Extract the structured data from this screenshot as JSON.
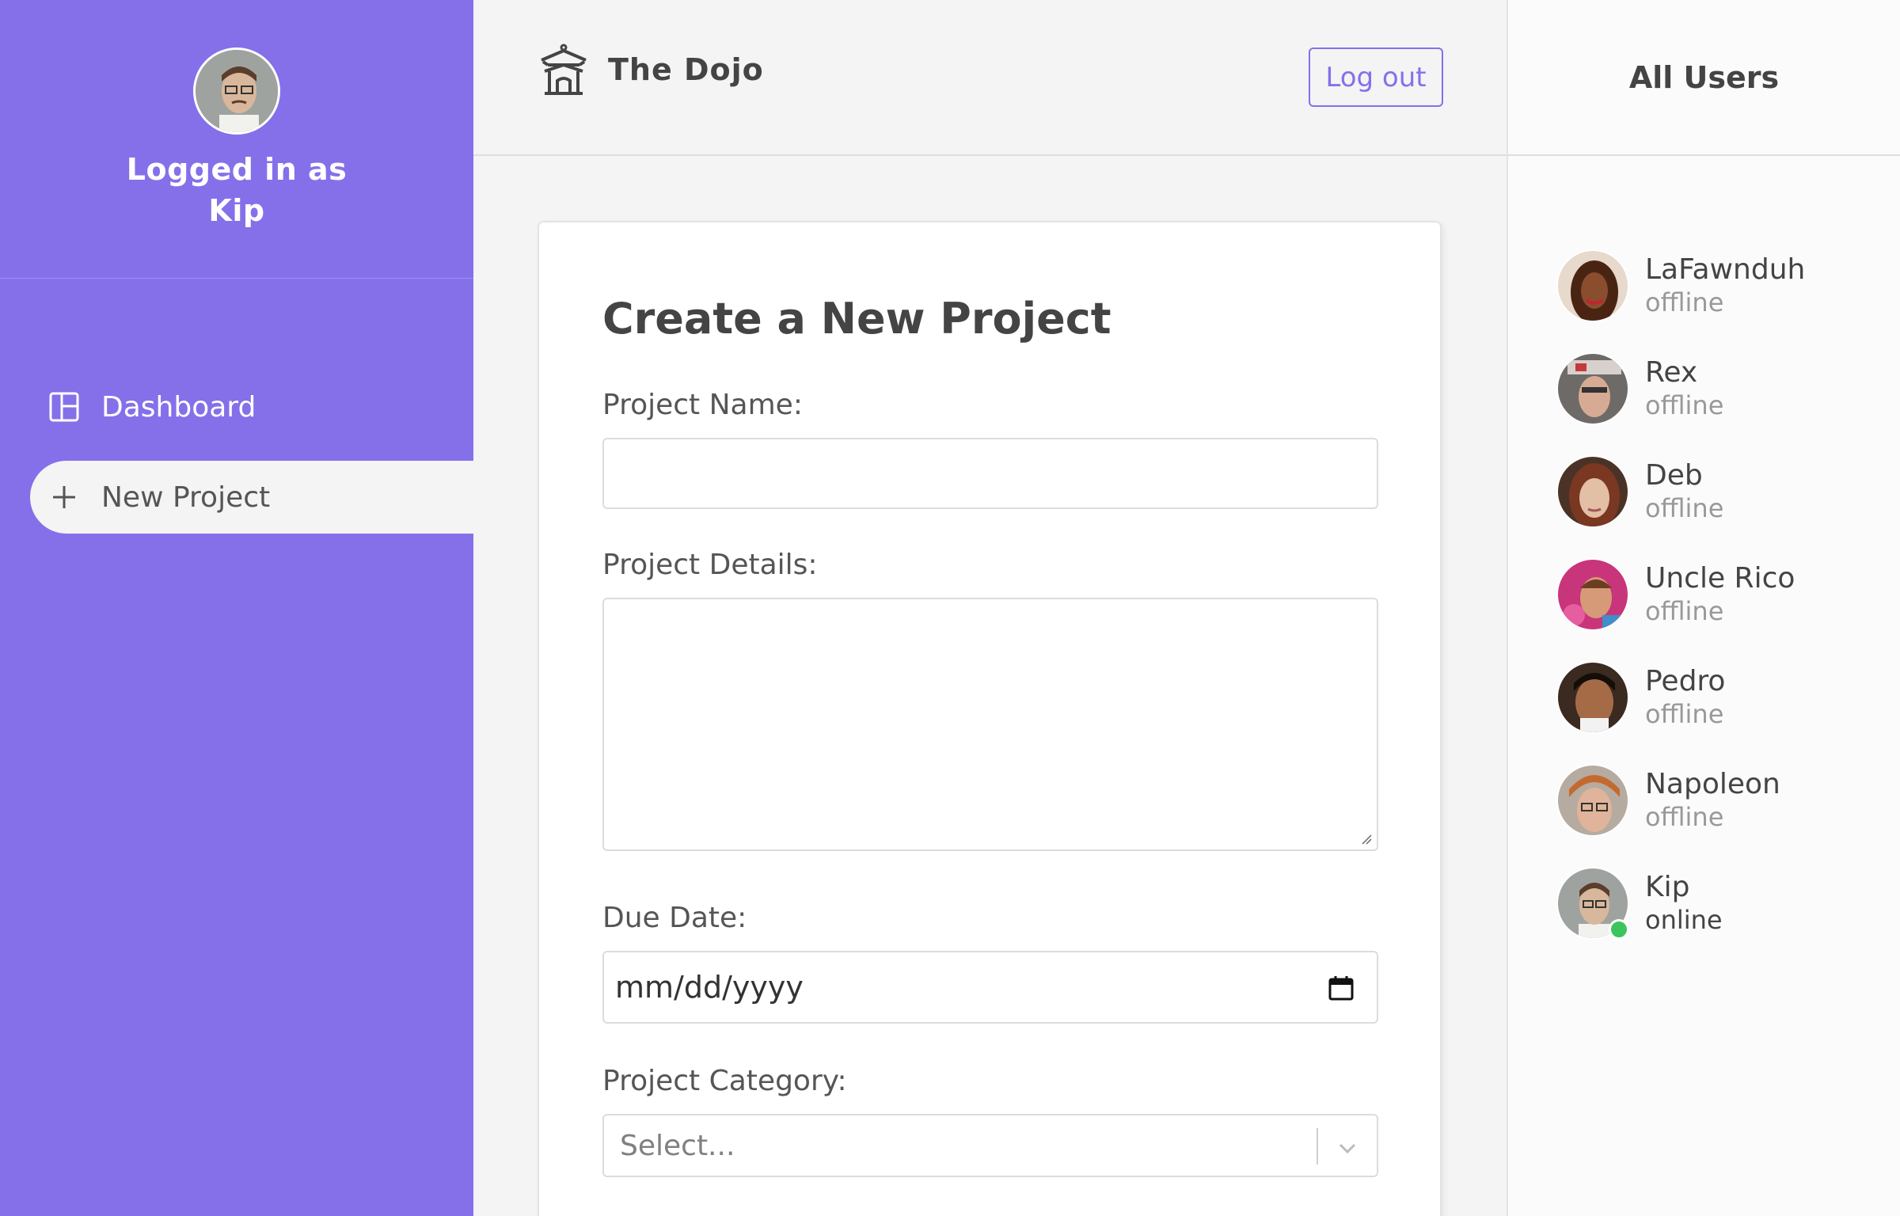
{
  "sidebar": {
    "login_text": "Logged in as Kip",
    "nav": [
      {
        "label": "Dashboard",
        "icon": "dashboard-icon"
      },
      {
        "label": "New Project",
        "icon": "plus-icon"
      }
    ]
  },
  "header": {
    "brand": "The Dojo",
    "logout_label": "Log out"
  },
  "form": {
    "title": "Create a New Project",
    "name_label": "Project Name:",
    "details_label": "Project Details:",
    "due_label": "Due Date:",
    "due_placeholder": "mm/dd/yyyy",
    "category_label": "Project Category:",
    "category_placeholder": "Select..."
  },
  "users": {
    "heading": "All Users",
    "list": [
      {
        "name": "LaFawnduh",
        "status": "offline"
      },
      {
        "name": "Rex",
        "status": "offline"
      },
      {
        "name": "Deb",
        "status": "offline"
      },
      {
        "name": "Uncle Rico",
        "status": "offline"
      },
      {
        "name": "Pedro",
        "status": "offline"
      },
      {
        "name": "Napoleon",
        "status": "offline"
      },
      {
        "name": "Kip",
        "status": "online"
      }
    ]
  },
  "colors": {
    "accent": "#8570ea",
    "online": "#3cc55c"
  }
}
